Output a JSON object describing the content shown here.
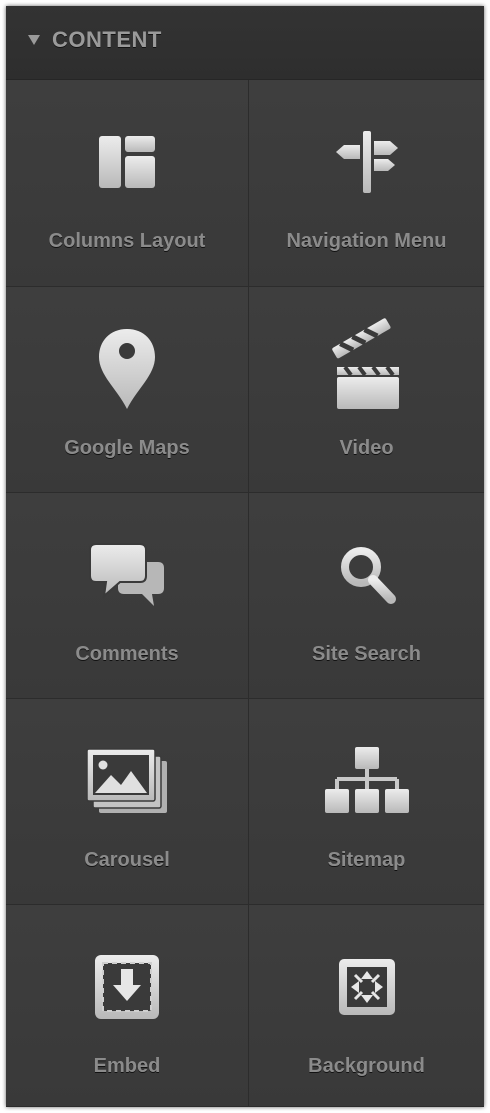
{
  "header": {
    "title": "CONTENT"
  },
  "tiles": [
    {
      "label": "Columns Layout",
      "icon": "columns-layout-icon"
    },
    {
      "label": "Navigation Menu",
      "icon": "signpost-icon"
    },
    {
      "label": "Google Maps",
      "icon": "map-pin-icon"
    },
    {
      "label": "Video",
      "icon": "clapperboard-icon"
    },
    {
      "label": "Comments",
      "icon": "speech-bubbles-icon"
    },
    {
      "label": "Site Search",
      "icon": "magnifier-icon"
    },
    {
      "label": "Carousel",
      "icon": "image-stack-icon"
    },
    {
      "label": "Sitemap",
      "icon": "sitemap-icon"
    },
    {
      "label": "Embed",
      "icon": "embed-download-icon"
    },
    {
      "label": "Background",
      "icon": "background-expand-icon"
    }
  ],
  "colors": {
    "panel": "#3b3b3b",
    "header": "#2e2e2e",
    "label": "#8b8b8b",
    "icon": "#d6d6d6"
  }
}
